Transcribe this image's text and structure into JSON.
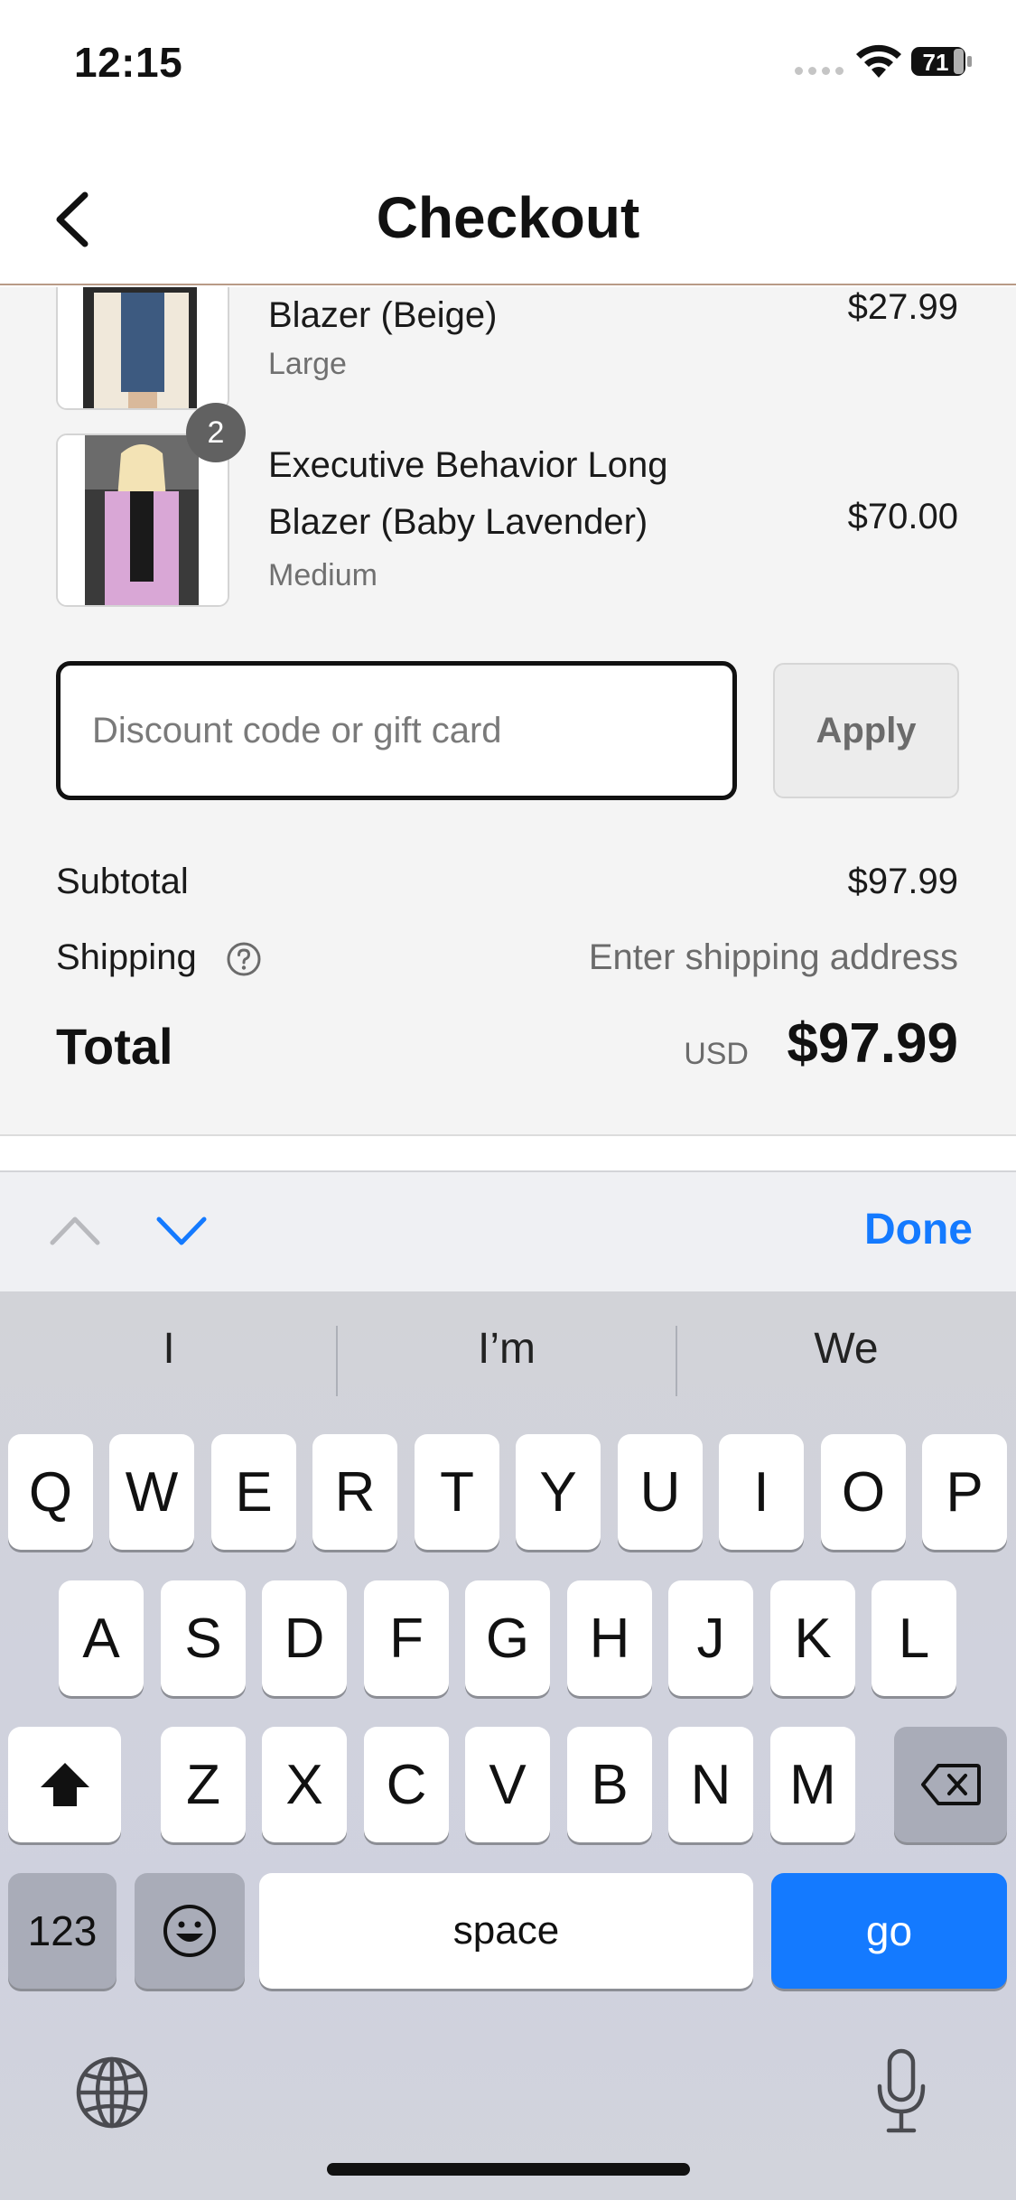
{
  "status_bar": {
    "time": "12:15",
    "battery": "71"
  },
  "header": {
    "title": "Checkout"
  },
  "cart": {
    "items": [
      {
        "name": "Blazer (Beige)",
        "variant": "Large",
        "price": "$27.99"
      },
      {
        "name": "Executive Behavior Long Blazer (Baby Lavender)",
        "variant": "Medium",
        "price": "$70.00",
        "quantity": "2"
      }
    ]
  },
  "discount": {
    "placeholder": "Discount code or gift card",
    "apply_label": "Apply"
  },
  "summary": {
    "subtotal_label": "Subtotal",
    "subtotal_value": "$97.99",
    "shipping_label": "Shipping",
    "shipping_value": "Enter shipping address",
    "total_label": "Total",
    "currency": "USD",
    "total_value": "$97.99"
  },
  "keyboard": {
    "done_label": "Done",
    "suggestions": [
      "I",
      "I’m",
      "We"
    ],
    "row1": [
      "Q",
      "W",
      "E",
      "R",
      "T",
      "Y",
      "U",
      "I",
      "O",
      "P"
    ],
    "row2": [
      "A",
      "S",
      "D",
      "F",
      "G",
      "H",
      "J",
      "K",
      "L"
    ],
    "row3": [
      "Z",
      "X",
      "C",
      "V",
      "B",
      "N",
      "M"
    ],
    "numbers_label": "123",
    "space_label": "space",
    "go_label": "go"
  },
  "colors": {
    "accent": "#147aff",
    "summary_bg": "#f4f4f4",
    "badge": "#616161"
  }
}
